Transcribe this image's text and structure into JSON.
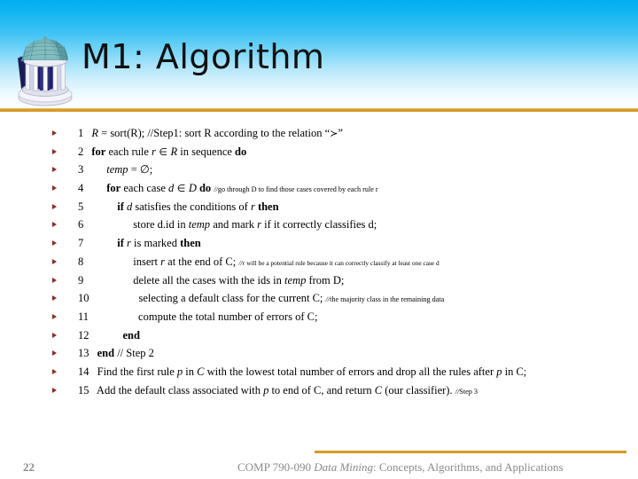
{
  "slide": {
    "title": "M1: Algorithm",
    "logo_alt": "old-well-logo",
    "page_number": "22",
    "footer": {
      "course": "COMP 790-090 ",
      "italic_part": "Data Mining",
      "rest": ": Concepts, Algorithms, and Applications"
    }
  },
  "colors": {
    "banner_top": "#00aeef",
    "banner_bottom": "#ffffff",
    "rule": "#d79b26",
    "bullet": "#8c2b2b",
    "footer_text": "#8a8a8a",
    "body_text": "#000000"
  },
  "algorithm": {
    "lines": [
      {
        "num": "1",
        "indent": 0,
        "parts": [
          {
            "t": " R",
            "s": "italic"
          },
          {
            "t": " = sort(R); //Step1: sort R according to the relation “",
            "s": "normal"
          },
          {
            "t": "≻",
            "s": "symbol"
          },
          {
            "t": "”",
            "s": "normal"
          }
        ],
        "plain": "1 R = sort(R); //Step1: sort R according to the relation “≻”"
      },
      {
        "num": "2",
        "indent": 0,
        "parts": [
          {
            "t": " for",
            "s": "bold"
          },
          {
            "t": " each rule ",
            "s": "normal"
          },
          {
            "t": "r",
            "s": "italic"
          },
          {
            "t": " ∈  ",
            "s": "symbol"
          },
          {
            "t": "R",
            "s": "italic"
          },
          {
            "t": " in sequence ",
            "s": "normal"
          },
          {
            "t": "do",
            "s": "bold"
          }
        ],
        "plain": "2 for each rule r ∈ R in sequence do"
      },
      {
        "num": "3",
        "indent": 1,
        "parts": [
          {
            "t": "temp",
            "s": "italic"
          },
          {
            "t": " = ∅;",
            "s": "normal"
          }
        ],
        "plain": "3 temp = ∅;"
      },
      {
        "num": "4",
        "indent": 1,
        "parts": [
          {
            "t": "for",
            "s": "bold"
          },
          {
            "t": " each case ",
            "s": "normal"
          },
          {
            "t": "d",
            "s": "italic"
          },
          {
            "t": " ∈  ",
            "s": "symbol"
          },
          {
            "t": "D",
            "s": "italic"
          },
          {
            "t": " ",
            "s": "normal"
          },
          {
            "t": "do",
            "s": "bold"
          },
          {
            "t": "  ",
            "s": "normal"
          },
          {
            "t": "//",
            "s": "italic-small"
          },
          {
            "t": "go through D to find those cases covered by  each rule r",
            "s": "small"
          }
        ],
        "plain": "4 for each case d ∈ D do //go through D to find those cases covered by each rule r"
      },
      {
        "num": "5",
        "indent": 2,
        "parts": [
          {
            "t": "if",
            "s": "bold"
          },
          {
            "t": " ",
            "s": "normal"
          },
          {
            "t": "d",
            "s": "italic"
          },
          {
            "t": " satisfies the conditions of ",
            "s": "normal"
          },
          {
            "t": "r",
            "s": "italic"
          },
          {
            "t": " ",
            "s": "normal"
          },
          {
            "t": "then",
            "s": "bold"
          }
        ],
        "plain": "5 if d satisfies the conditions of r then"
      },
      {
        "num": "6",
        "indent": 3,
        "parts": [
          {
            "t": "store d.id in ",
            "s": "normal"
          },
          {
            "t": "temp",
            "s": "italic"
          },
          {
            "t": " and mark ",
            "s": "normal"
          },
          {
            "t": "r",
            "s": "italic"
          },
          {
            "t": " if it correctly classifies d;",
            "s": "normal"
          }
        ],
        "plain": "6 store d.id in temp and mark r if it correctly classifies d;"
      },
      {
        "num": "7",
        "indent": 2,
        "parts": [
          {
            "t": "if",
            "s": "bold"
          },
          {
            "t": " ",
            "s": "normal"
          },
          {
            "t": "r",
            "s": "italic"
          },
          {
            "t": " is marked ",
            "s": "normal"
          },
          {
            "t": "then",
            "s": "bold"
          }
        ],
        "plain": "7 if r is marked then"
      },
      {
        "num": "8",
        "indent": 3,
        "parts": [
          {
            "t": "insert ",
            "s": "normal"
          },
          {
            "t": "r",
            "s": "italic"
          },
          {
            "t": " at the end of C;  ",
            "s": "normal"
          },
          {
            "t": "//r",
            "s": "italic-tiny"
          },
          {
            "t": " will be a potential rule because it can correctly classify at least one case d",
            "s": "tiny"
          }
        ],
        "plain": "8 insert r at the end of C; //r will be a potential rule because it can correctly classify at least one case d"
      },
      {
        "num": "9",
        "indent": 3,
        "parts": [
          {
            "t": "delete all the cases with the ids in ",
            "s": "normal"
          },
          {
            "t": "temp",
            "s": "italic"
          },
          {
            "t": " from D;",
            "s": "normal"
          }
        ],
        "plain": "9 delete all the cases with the ids in temp from D;"
      },
      {
        "num": "10",
        "indent": 3,
        "parts": [
          {
            "t": "selecting a default class for the current C; ",
            "s": "normal"
          },
          {
            "t": "//",
            "s": "italic-small"
          },
          {
            "t": "the majority class in the remaining data",
            "s": "small"
          }
        ],
        "plain": "10 selecting a default class for the current C; //the majority class in the remaining data"
      },
      {
        "num": "11",
        "indent": 3,
        "parts": [
          {
            "t": "compute the total number of errors of C;",
            "s": "normal"
          }
        ],
        "plain": "11 compute the total number of errors of C;"
      },
      {
        "num": "12",
        "indent": 2,
        "parts": [
          {
            "t": "end",
            "s": "bold"
          }
        ],
        "plain": "12 end"
      },
      {
        "num": "13",
        "indent": 0,
        "parts": [
          {
            "t": " ",
            "s": "normal"
          },
          {
            "t": "end",
            "s": "bold"
          },
          {
            "t": " // Step 2",
            "s": "normal"
          }
        ],
        "plain": "13 end // Step 2"
      },
      {
        "num": "14",
        "indent": 0,
        "parts": [
          {
            "t": " Find the first rule ",
            "s": "normal"
          },
          {
            "t": "p",
            "s": "italic"
          },
          {
            "t": " in ",
            "s": "normal"
          },
          {
            "t": "C",
            "s": "italic"
          },
          {
            "t": " with the lowest total number of errors and drop all the rules after ",
            "s": "normal"
          },
          {
            "t": "p",
            "s": "italic"
          },
          {
            "t": " in C;",
            "s": "normal"
          }
        ],
        "plain": "14 Find the first rule p in C with the lowest total number of errors and drop all the rules after p in C;"
      },
      {
        "num": "15",
        "indent": 0,
        "parts": [
          {
            "t": " Add the default class associated with ",
            "s": "normal"
          },
          {
            "t": "p",
            "s": "italic"
          },
          {
            "t": " to end of C, and return ",
            "s": "normal"
          },
          {
            "t": "C",
            "s": "italic"
          },
          {
            "t": " (our classifier). ",
            "s": "normal"
          },
          {
            "t": "//",
            "s": "italic-small"
          },
          {
            "t": "Step 3",
            "s": "small"
          }
        ],
        "plain": "15 Add the default class associated with p to end of C, and return C (our classifier). //Step 3"
      }
    ]
  }
}
